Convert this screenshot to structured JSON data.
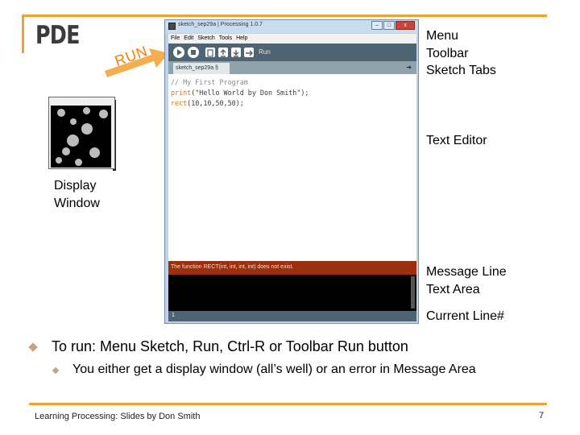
{
  "slide": {
    "title": "PDE",
    "run_label": "RUN",
    "footer": "Learning Processing:  Slides by Don Smith",
    "page_number": "7",
    "accent_color": "#f0a030"
  },
  "ide": {
    "window_title": "sketch_sep29a | Processing 1.0.7",
    "menu": [
      "File",
      "Edit",
      "Sketch",
      "Tools",
      "Help"
    ],
    "toolbar_label": "Run",
    "tab_name": "sketch_sep29a §",
    "code": {
      "line1": "// My First Program",
      "line2_kw": "print",
      "line2_rest": "(\"Hello World by Don Smith\");",
      "line3_kw": "rect",
      "line3_rest": "(10,10,50,50);"
    },
    "message": "The function RECT(int, int, int, int) does not exist.",
    "current_line": "1",
    "window_buttons": [
      "–",
      "□",
      "x"
    ],
    "colors": {
      "toolbar": "#4f6472",
      "message_bar": "#9c2f0f",
      "console": "#000000"
    }
  },
  "labels": {
    "menu": "Menu",
    "toolbar": "Toolbar",
    "sketch_tabs": "Sketch Tabs",
    "text_editor": "Text Editor",
    "display_window_line1": "Display",
    "display_window_line2": "Window",
    "message_line": "Message Line",
    "text_area": "Text Area",
    "current_line": "Current Line#"
  },
  "bullets": {
    "level1": "To run:  Menu Sketch, Run, Ctrl-R or Toolbar Run button",
    "level2": "You either get a display window (all’s well) or an error in Message Area"
  }
}
